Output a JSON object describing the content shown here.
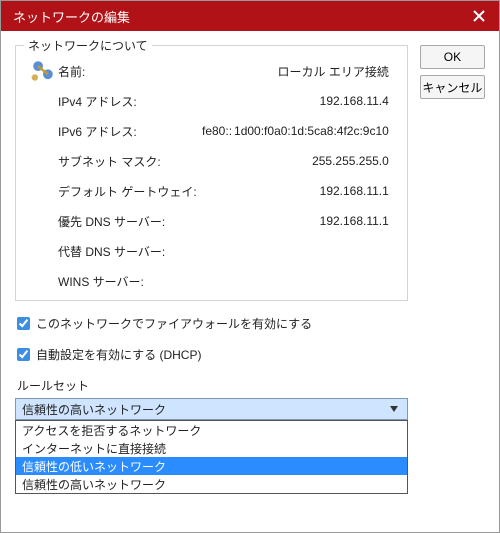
{
  "window": {
    "title": "ネットワークの編集"
  },
  "buttons": {
    "ok": "OK",
    "cancel": "キャンセル"
  },
  "section": {
    "legend": "ネットワークについて"
  },
  "fields": {
    "name_label": "名前:",
    "name_value": "ローカル エリア接続",
    "ipv4_label": "IPv4 アドレス:",
    "ipv4_value": "192.168.11.4",
    "ipv6_label": "IPv6 アドレス:",
    "ipv6_prefix": "fe80::",
    "ipv6_hidden": "1d00:f0a0:1d:5ca8:4f2c:9c10",
    "subnet_label": "サブネット マスク:",
    "subnet_value": "255.255.255.0",
    "gateway_label": "デフォルト ゲートウェイ:",
    "gateway_value": "192.168.11.1",
    "dns1_label": "優先 DNS サーバー:",
    "dns1_value": "192.168.11.1",
    "dns2_label": "代替 DNS サーバー:",
    "dns2_value": "",
    "wins_label": "WINS サーバー:",
    "wins_value": ""
  },
  "checkboxes": {
    "fw_label": "このネットワークでファイアウォールを有効にする",
    "dhcp_label": "自動設定を有効にする (DHCP)"
  },
  "ruleset": {
    "label": "ルールセット",
    "selected": "信頼性の高いネットワーク",
    "options": [
      "アクセスを拒否するネットワーク",
      "インターネットに直接接続",
      "信頼性の低いネットワーク",
      "信頼性の高いネットワーク"
    ],
    "highlight_index": 2
  }
}
